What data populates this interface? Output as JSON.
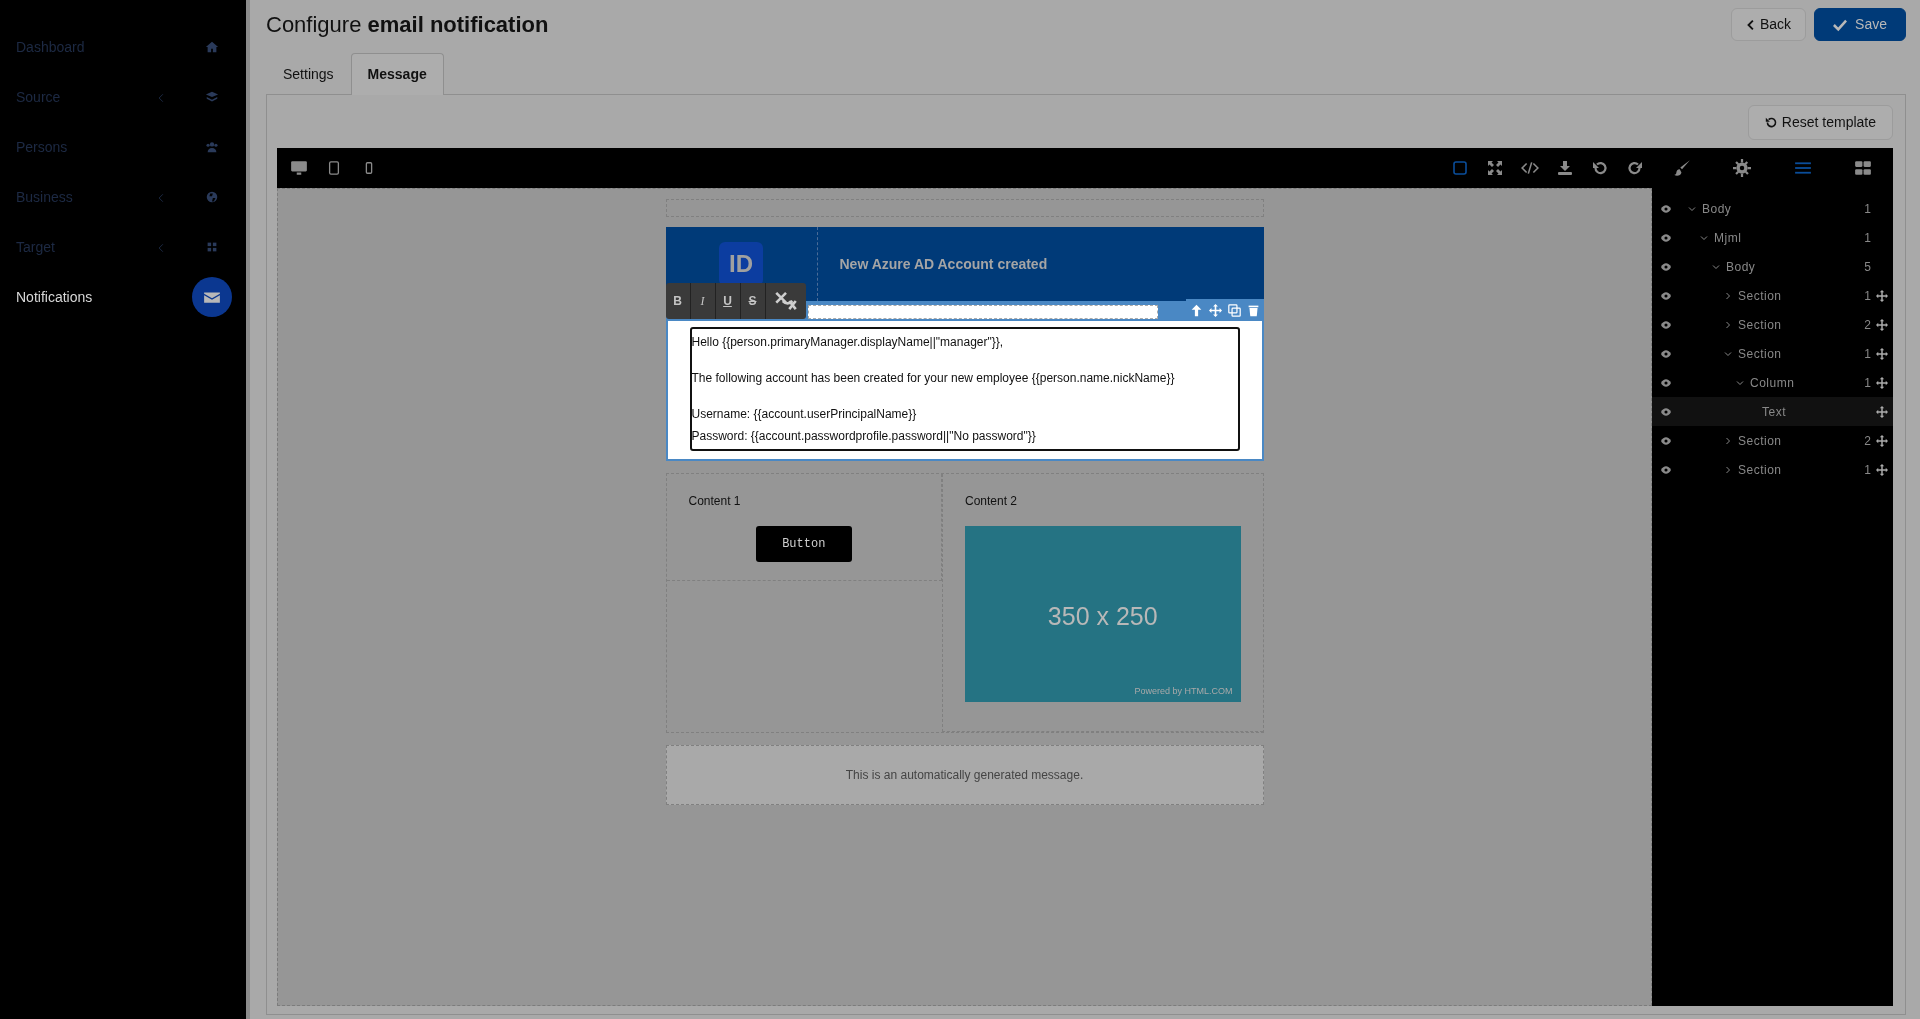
{
  "sidebar": {
    "items": [
      {
        "label": "Dashboard",
        "selected": false,
        "submenu": false
      },
      {
        "label": "Source",
        "selected": false,
        "submenu": true
      },
      {
        "label": "Persons",
        "selected": false,
        "submenu": false
      },
      {
        "label": "Business",
        "selected": false,
        "submenu": true
      },
      {
        "label": "Target",
        "selected": false,
        "submenu": true
      },
      {
        "label": "Notifications",
        "selected": true,
        "submenu": false
      }
    ]
  },
  "header": {
    "title": "Configure **email notification**",
    "buttons": [
      {
        "kind": "back",
        "label": "Back"
      },
      {
        "kind": "save",
        "label": "Save"
      }
    ]
  },
  "tabs": [
    {
      "label": "Settings",
      "selected": false
    },
    {
      "label": "Message",
      "selected": true
    }
  ],
  "reset_button": "Reset template",
  "editor": {
    "devices": [
      {
        "kind": "desktop",
        "active": false
      },
      {
        "kind": "tablet",
        "active": false
      },
      {
        "kind": "mobile",
        "active": false
      }
    ],
    "commands": [
      {
        "kind": "outline",
        "active": true
      },
      {
        "kind": "fullscreen",
        "active": false
      },
      {
        "kind": "code",
        "active": false
      },
      {
        "kind": "export",
        "active": false
      },
      {
        "kind": "undo",
        "active": false
      },
      {
        "kind": "redo",
        "active": false
      }
    ],
    "panels": [
      {
        "kind": "style",
        "active": false
      },
      {
        "kind": "settings",
        "active": false
      },
      {
        "kind": "layers",
        "active": true
      },
      {
        "kind": "blocks",
        "active": false
      }
    ],
    "email": {
      "logo": "ID",
      "heading": "New Azure AD Account created",
      "rte_buttons": [
        {
          "kind": "bold",
          "label": "B"
        },
        {
          "kind": "italic",
          "label": "I"
        },
        {
          "kind": "underline",
          "label": "U"
        },
        {
          "kind": "strike",
          "label": "S"
        },
        {
          "kind": "link"
        }
      ],
      "paragraphs": [
        [
          "Hello {{person.primaryManager.displayName||\"manager\"}},"
        ],
        [
          "The following account has been created for your new employee {{person.name.nickName}}"
        ],
        [
          "Username: {{account.userPrincipalName}}",
          "Password: {{account.passwordprofile.password||\"No password\"}}"
        ]
      ],
      "columns": [
        {
          "title": "Content 1",
          "button": "Button"
        },
        {
          "title": "Content 2",
          "image_label": "350 x 250",
          "image_credit": "Powered by HTML.COM"
        }
      ],
      "footer": "This is an automatically generated message."
    },
    "layers": [
      {
        "label": "Body",
        "count": "1",
        "kind": "group",
        "expanded": true,
        "selected": false,
        "movable": false,
        "children": [
          {
            "label": "Mjml",
            "count": "1",
            "kind": "group",
            "expanded": true,
            "selected": false,
            "movable": false,
            "children": [
              {
                "label": "Body",
                "count": "5",
                "kind": "group",
                "expanded": true,
                "selected": false,
                "movable": false,
                "children": [
                  {
                    "label": "Section",
                    "count": "1",
                    "kind": "group",
                    "expanded": false,
                    "selected": false,
                    "movable": true
                  },
                  {
                    "label": "Section",
                    "count": "2",
                    "kind": "group",
                    "expanded": false,
                    "selected": false,
                    "movable": true
                  },
                  {
                    "label": "Section",
                    "count": "1",
                    "kind": "group",
                    "expanded": true,
                    "selected": false,
                    "movable": true,
                    "children": [
                      {
                        "label": "Column",
                        "count": "1",
                        "kind": "group",
                        "expanded": true,
                        "selected": false,
                        "movable": true,
                        "children": [
                          {
                            "label": "Text",
                            "kind": "leaf",
                            "selected": true,
                            "movable": true
                          }
                        ]
                      }
                    ]
                  },
                  {
                    "label": "Section",
                    "count": "2",
                    "kind": "group",
                    "expanded": false,
                    "selected": false,
                    "movable": true
                  },
                  {
                    "label": "Section",
                    "count": "1",
                    "kind": "group",
                    "expanded": false,
                    "selected": false,
                    "movable": true
                  }
                ]
              }
            ]
          }
        ]
      }
    ]
  }
}
